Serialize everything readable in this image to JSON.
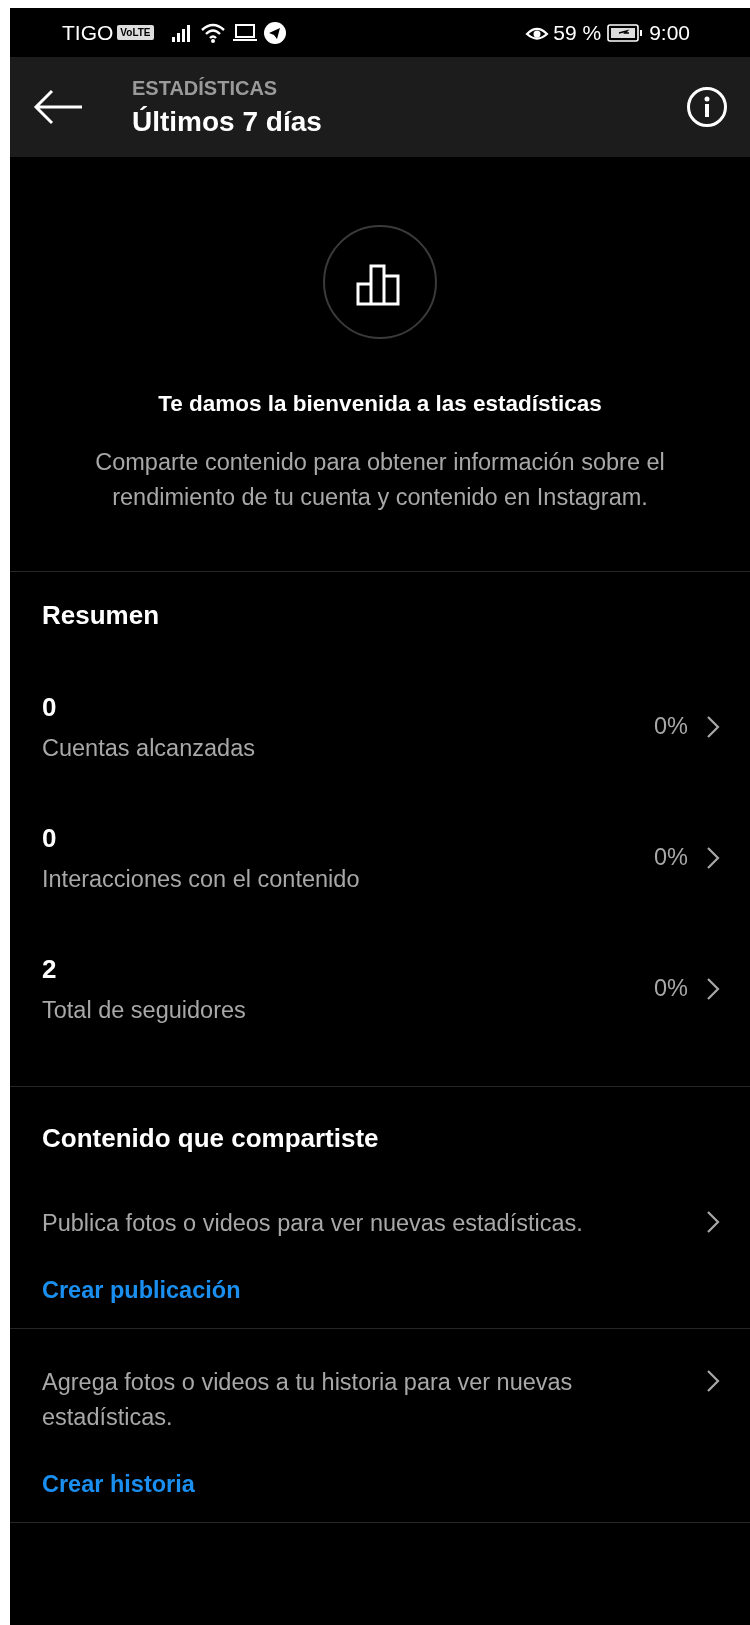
{
  "status_bar": {
    "carrier": "TIGO",
    "volte": "VoLTE",
    "battery_text": "59 %",
    "time": "9:00"
  },
  "header": {
    "overline": "ESTADÍSTICAS",
    "title": "Últimos 7 días"
  },
  "welcome": {
    "title": "Te damos la bienvenida a las estadísticas",
    "text": "Comparte contenido para obtener información sobre el rendimiento de tu cuenta y contenido en Instagram."
  },
  "summary": {
    "title": "Resumen",
    "rows": [
      {
        "value": "0",
        "label": "Cuentas alcanzadas",
        "change": "0%"
      },
      {
        "value": "0",
        "label": "Interacciones con el contenido",
        "change": "0%"
      },
      {
        "value": "2",
        "label": "Total de seguidores",
        "change": "0%"
      }
    ]
  },
  "shared": {
    "title": "Contenido que compartiste",
    "items": [
      {
        "text": "Publica fotos o videos para ver nuevas estadísticas.",
        "link": "Crear publicación"
      },
      {
        "text": "Agrega fotos o videos a tu historia para ver nuevas estadísticas.",
        "link": "Crear historia"
      }
    ]
  }
}
